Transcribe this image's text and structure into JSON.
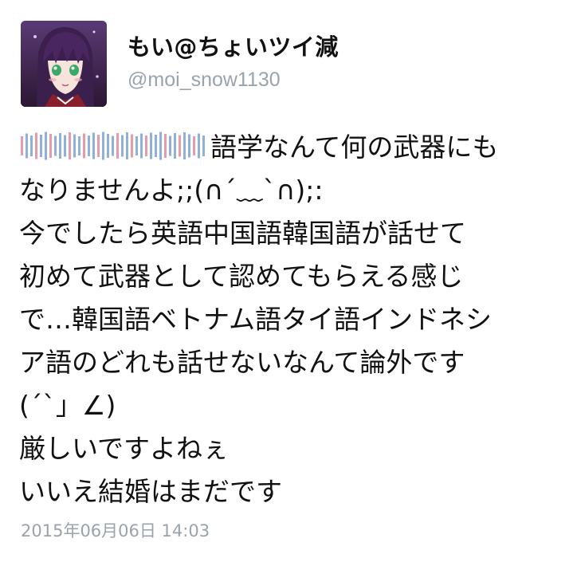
{
  "user": {
    "display_name": "もい@ちょいツイ減",
    "handle": "@moi_snow1130",
    "avatar": "anime-girl-avatar"
  },
  "tweet": {
    "line1_tail": "語学なんて何の武器にも",
    "lines": [
      "なりませんよ;;(∩´﹏`∩);:",
      "今でしたら英語中国語韓国語が話せて",
      "初めて武器として認めてもらえる感じ",
      "で…韓国語ベトナム語タイ語インドネシ",
      "ア語のどれも話せないなんて論外です",
      "(´`」∠)",
      "厳しいですよねぇ",
      "いいえ結婚はまだです"
    ],
    "timestamp": "2015年06月06日 14:03"
  },
  "colors": {
    "redaction_pink": "#e79aa8",
    "redaction_blue": "#8fb0dc",
    "meta_gray": "#9aa3ad"
  }
}
